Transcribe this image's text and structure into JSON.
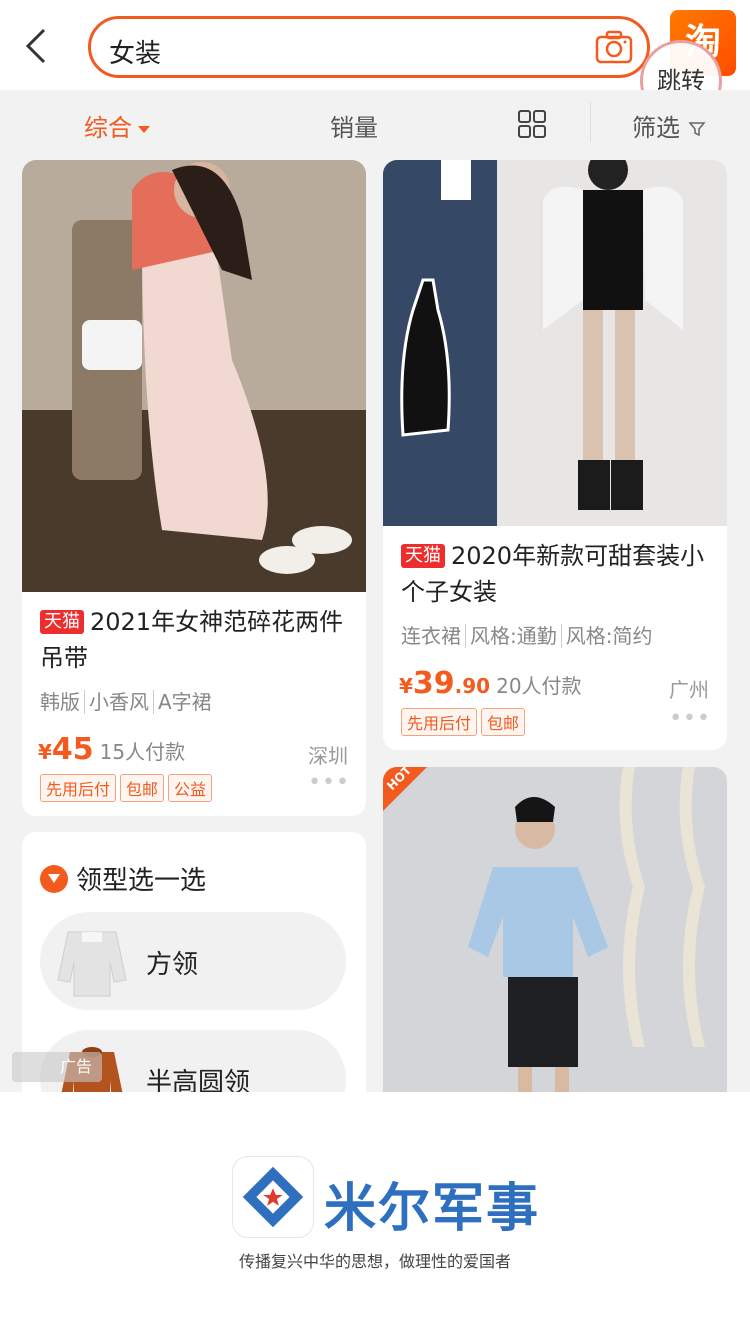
{
  "header": {
    "search_value": "女装",
    "jump_label": "跳转",
    "taobao_logo": "淘"
  },
  "sortbar": {
    "comprehensive": "综合",
    "sales": "销量",
    "filter": "筛选"
  },
  "products": [
    {
      "badge": "天猫",
      "title": "2021年女神范碎花两件吊带",
      "tags": [
        "韩版",
        "小香风",
        "A字裙"
      ],
      "price_symbol": "¥",
      "price_int": "45",
      "price_dec": "",
      "sold": "15人付款",
      "city": "深圳",
      "labels": [
        "先用后付",
        "包邮",
        "公益"
      ]
    },
    {
      "badge": "天猫",
      "title": "2020年新款可甜套装小个子女装",
      "tags": [
        "连衣裙",
        "风格:通勤",
        "风格:简约"
      ],
      "price_symbol": "¥",
      "price_int": "39",
      "price_dec": ".90",
      "sold": "20人付款",
      "city": "广州",
      "labels": [
        "先用后付",
        "包邮"
      ]
    }
  ],
  "neckline": {
    "title": "领型选一选",
    "options": [
      "方领",
      "半高圆领"
    ]
  },
  "hot_label": "HOT",
  "ad_label": "广告",
  "footer": {
    "brand": "米尔军事",
    "slogan": "传播复兴中华的思想，做理性的爱国者"
  },
  "more_dots": "•••"
}
